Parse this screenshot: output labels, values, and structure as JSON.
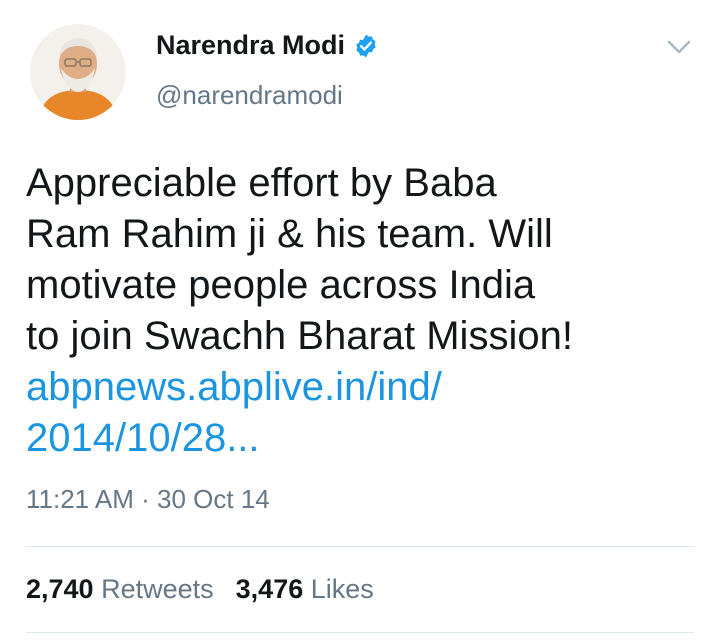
{
  "user": {
    "display_name": "Narendra Modi",
    "handle": "@narendramodi",
    "verified": true,
    "avatar_icon": "profile-photo"
  },
  "tweet": {
    "lines": [
      "Appreciable effort by Baba",
      "Ram Rahim ji & his team. Will",
      "motivate people across India",
      "to join Swachh Bharat Mission!"
    ],
    "link_lines": [
      "abpnews.abplive.in/ind/",
      "2014/10/28..."
    ],
    "timestamp": "11:21 AM · 30 Oct 14"
  },
  "stats": {
    "retweets_count": "2,740",
    "retweets_label": "Retweets",
    "likes_count": "3,476",
    "likes_label": "Likes"
  },
  "colors": {
    "link": "#1b95e0",
    "verified_badge": "#1da1f2",
    "secondary_text": "#657786"
  },
  "icons": {
    "menu": "chevron-down-icon",
    "verified": "verified-badge-icon"
  }
}
